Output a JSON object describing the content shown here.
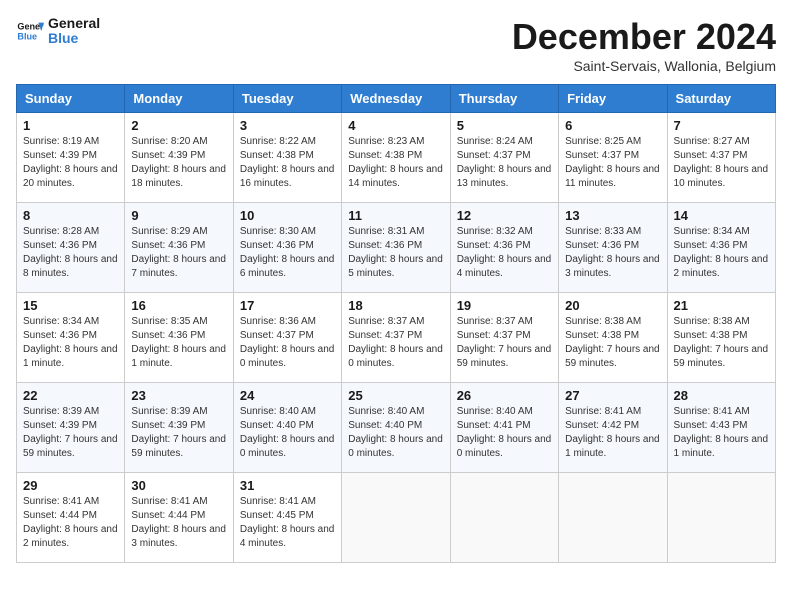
{
  "header": {
    "logo_text_general": "General",
    "logo_text_blue": "Blue",
    "month_title": "December 2024",
    "subtitle": "Saint-Servais, Wallonia, Belgium"
  },
  "weekdays": [
    "Sunday",
    "Monday",
    "Tuesday",
    "Wednesday",
    "Thursday",
    "Friday",
    "Saturday"
  ],
  "weeks": [
    [
      {
        "day": "1",
        "sunrise": "8:19 AM",
        "sunset": "4:39 PM",
        "daylight": "8 hours and 20 minutes."
      },
      {
        "day": "2",
        "sunrise": "8:20 AM",
        "sunset": "4:39 PM",
        "daylight": "8 hours and 18 minutes."
      },
      {
        "day": "3",
        "sunrise": "8:22 AM",
        "sunset": "4:38 PM",
        "daylight": "8 hours and 16 minutes."
      },
      {
        "day": "4",
        "sunrise": "8:23 AM",
        "sunset": "4:38 PM",
        "daylight": "8 hours and 14 minutes."
      },
      {
        "day": "5",
        "sunrise": "8:24 AM",
        "sunset": "4:37 PM",
        "daylight": "8 hours and 13 minutes."
      },
      {
        "day": "6",
        "sunrise": "8:25 AM",
        "sunset": "4:37 PM",
        "daylight": "8 hours and 11 minutes."
      },
      {
        "day": "7",
        "sunrise": "8:27 AM",
        "sunset": "4:37 PM",
        "daylight": "8 hours and 10 minutes."
      }
    ],
    [
      {
        "day": "8",
        "sunrise": "8:28 AM",
        "sunset": "4:36 PM",
        "daylight": "8 hours and 8 minutes."
      },
      {
        "day": "9",
        "sunrise": "8:29 AM",
        "sunset": "4:36 PM",
        "daylight": "8 hours and 7 minutes."
      },
      {
        "day": "10",
        "sunrise": "8:30 AM",
        "sunset": "4:36 PM",
        "daylight": "8 hours and 6 minutes."
      },
      {
        "day": "11",
        "sunrise": "8:31 AM",
        "sunset": "4:36 PM",
        "daylight": "8 hours and 5 minutes."
      },
      {
        "day": "12",
        "sunrise": "8:32 AM",
        "sunset": "4:36 PM",
        "daylight": "8 hours and 4 minutes."
      },
      {
        "day": "13",
        "sunrise": "8:33 AM",
        "sunset": "4:36 PM",
        "daylight": "8 hours and 3 minutes."
      },
      {
        "day": "14",
        "sunrise": "8:34 AM",
        "sunset": "4:36 PM",
        "daylight": "8 hours and 2 minutes."
      }
    ],
    [
      {
        "day": "15",
        "sunrise": "8:34 AM",
        "sunset": "4:36 PM",
        "daylight": "8 hours and 1 minute."
      },
      {
        "day": "16",
        "sunrise": "8:35 AM",
        "sunset": "4:36 PM",
        "daylight": "8 hours and 1 minute."
      },
      {
        "day": "17",
        "sunrise": "8:36 AM",
        "sunset": "4:37 PM",
        "daylight": "8 hours and 0 minutes."
      },
      {
        "day": "18",
        "sunrise": "8:37 AM",
        "sunset": "4:37 PM",
        "daylight": "8 hours and 0 minutes."
      },
      {
        "day": "19",
        "sunrise": "8:37 AM",
        "sunset": "4:37 PM",
        "daylight": "7 hours and 59 minutes."
      },
      {
        "day": "20",
        "sunrise": "8:38 AM",
        "sunset": "4:38 PM",
        "daylight": "7 hours and 59 minutes."
      },
      {
        "day": "21",
        "sunrise": "8:38 AM",
        "sunset": "4:38 PM",
        "daylight": "7 hours and 59 minutes."
      }
    ],
    [
      {
        "day": "22",
        "sunrise": "8:39 AM",
        "sunset": "4:39 PM",
        "daylight": "7 hours and 59 minutes."
      },
      {
        "day": "23",
        "sunrise": "8:39 AM",
        "sunset": "4:39 PM",
        "daylight": "7 hours and 59 minutes."
      },
      {
        "day": "24",
        "sunrise": "8:40 AM",
        "sunset": "4:40 PM",
        "daylight": "8 hours and 0 minutes."
      },
      {
        "day": "25",
        "sunrise": "8:40 AM",
        "sunset": "4:40 PM",
        "daylight": "8 hours and 0 minutes."
      },
      {
        "day": "26",
        "sunrise": "8:40 AM",
        "sunset": "4:41 PM",
        "daylight": "8 hours and 0 minutes."
      },
      {
        "day": "27",
        "sunrise": "8:41 AM",
        "sunset": "4:42 PM",
        "daylight": "8 hours and 1 minute."
      },
      {
        "day": "28",
        "sunrise": "8:41 AM",
        "sunset": "4:43 PM",
        "daylight": "8 hours and 1 minute."
      }
    ],
    [
      {
        "day": "29",
        "sunrise": "8:41 AM",
        "sunset": "4:44 PM",
        "daylight": "8 hours and 2 minutes."
      },
      {
        "day": "30",
        "sunrise": "8:41 AM",
        "sunset": "4:44 PM",
        "daylight": "8 hours and 3 minutes."
      },
      {
        "day": "31",
        "sunrise": "8:41 AM",
        "sunset": "4:45 PM",
        "daylight": "8 hours and 4 minutes."
      },
      null,
      null,
      null,
      null
    ]
  ]
}
